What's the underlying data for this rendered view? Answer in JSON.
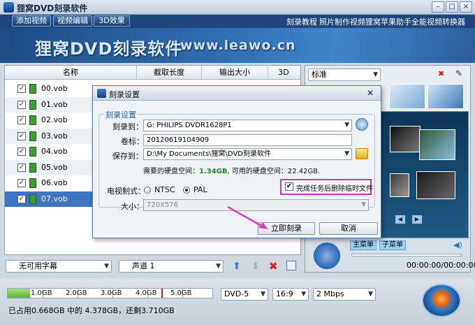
{
  "window": {
    "title": "狸窝DVD刻录软件",
    "minimize": "–",
    "maximize": "□",
    "close": "×"
  },
  "menubar": {
    "buttons": [
      "添加视频",
      "视频编辑",
      "3D效果"
    ],
    "links": [
      "刻录教程",
      "照片制作视频",
      "狸窝苹果助手",
      "全能视频转换器"
    ]
  },
  "banner": {
    "title": "狸窝DVD刻录软件",
    "url": "www.leawo.cn"
  },
  "file_list": {
    "columns": [
      "名称",
      "截取长度",
      "输出大小",
      "3D"
    ],
    "rows": [
      {
        "name": "00.vob",
        "checked": true
      },
      {
        "name": "01.vob",
        "checked": true
      },
      {
        "name": "02.vob",
        "checked": true
      },
      {
        "name": "03.vob",
        "checked": true
      },
      {
        "name": "04.vob",
        "checked": true
      },
      {
        "name": "05.vob",
        "checked": true
      },
      {
        "name": "06.vob",
        "checked": true
      },
      {
        "name": "07.vob",
        "checked": true
      }
    ],
    "selected_index": 7
  },
  "left_toolbar": {
    "subtitle": "无可用字幕",
    "audio": "声道 1"
  },
  "capacity": {
    "marks": [
      "1.0GB",
      "2.0GB",
      "3.0GB",
      "4.0GB",
      "5.0GB"
    ],
    "used_fraction": 0.11,
    "status": "已占用0.668GB 中的 4.378GB，还剩3.710GB",
    "disc_type": "DVD-5",
    "aspect": "16:9",
    "bitrate": "2 Mbps"
  },
  "right_panel": {
    "template": "标准",
    "main_menu_tab": "主菜单",
    "sub_menu_tab": "子菜单",
    "time": "00:00:00/00:00:00"
  },
  "dialog": {
    "title": "刻录设置",
    "group_label": "刻录设置",
    "burn_to_label": "刻录到：",
    "burn_to_value": "G: PHILIPS  DVDR1628P1",
    "volume_label": "卷标：",
    "volume_value": "20120619104909",
    "save_to_label": "保存到：",
    "save_to_value": "D:\\My Documents\\狸窝\\DVD刻录软件",
    "space_prefix": "需要的硬盘空间：",
    "space_required": "1.34GB",
    "space_middle": ", 可用的硬盘空间：",
    "space_available": "22.42GB.",
    "tv_format_label": "电视制式：",
    "ntsc": "NTSC",
    "pal": "PAL",
    "tv_format_selected": "PAL",
    "delete_temp_label": "完成任务后删除临时文件",
    "delete_temp_checked": true,
    "size_label": "大小：",
    "size_value": "720X576",
    "burn_button": "立即刻录",
    "cancel_button": "取消",
    "colors": {
      "space_required": "#1f8a1f",
      "highlight": "#c73aa9",
      "arrow": "#e040b8"
    }
  }
}
